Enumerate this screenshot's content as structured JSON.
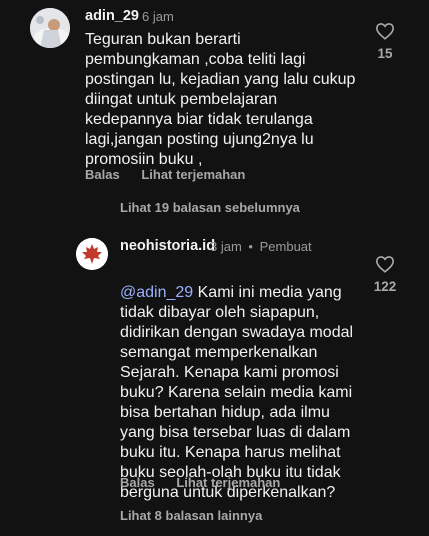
{
  "comment1": {
    "username": "adin_29",
    "time": "6 jam",
    "text": "Teguran bukan berarti\npembungkaman ,coba teliti lagi\npostingan lu, kejadian yang lalu cukup\ndiingat untuk pembelajaran\nkedepannya biar tidak terulanga\nlagi,jangan posting ujung2nya lu\npromosiin buku ,",
    "likes": "15",
    "reply_label": "Balas",
    "translate_label": "Lihat terjemahan",
    "replies_label": "Lihat 19 balasan sebelumnya"
  },
  "comment2": {
    "username": "neohistoria.id",
    "time": "3 jam",
    "separator": "•",
    "author_badge": "Pembuat",
    "mention": "@adin_29",
    "text": " Kami ini media yang\ntidak dibayar oleh siapapun,\ndidirikan dengan swadaya modal\nsemangat memperkenalkan\nSejarah. Kenapa kami promosi\nbuku? Karena selain media kami\nbisa bertahan hidup, ada ilmu\nyang bisa tersebar luas di dalam\nbuku itu. Kenapa harus melihat\nbuku seolah-olah buku itu tidak\nberguna untuk diperkenalkan?",
    "likes": "122",
    "reply_label": "Balas",
    "translate_label": "Lihat terjemahan",
    "replies_label": "Lihat 8 balasan lainnya"
  },
  "colors": {
    "background": "#121212",
    "text": "#f2f2f2",
    "muted": "#a8a8a8",
    "mention": "#9bb0ff",
    "logo_red": "#c0392b"
  }
}
